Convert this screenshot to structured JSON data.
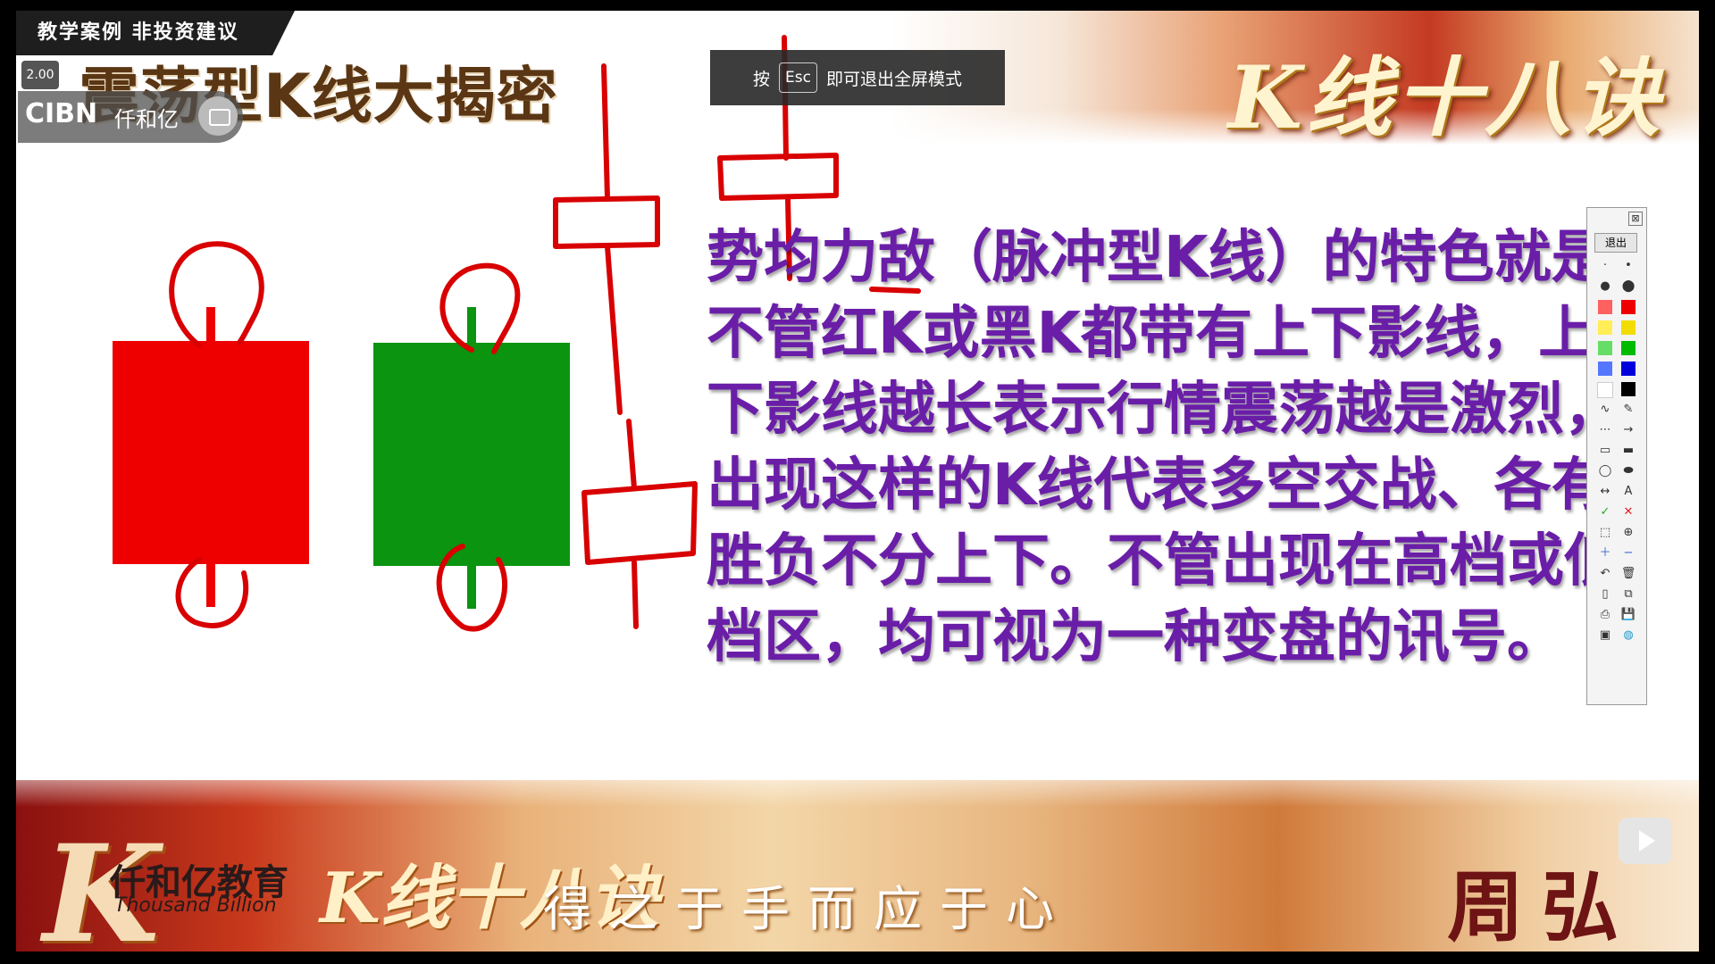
{
  "header": {
    "badge": "教学案例 非投资建议",
    "title": "震荡型K线大揭密",
    "channel": "CIBN",
    "channel_sub": "仟和亿",
    "speed": "2.00",
    "brand_title": "K线十八诀"
  },
  "fullscreen_tip": {
    "prefix": "按",
    "key": "Esc",
    "suffix": "即可退出全屏模式"
  },
  "content": {
    "paragraph": "势均力敌（脉冲型K线）的特色就是不管红K或黑K都带有上下影线，上下影线越长表示行情震荡越是激烈，出现这样的K线代表多空交战、各有胜负不分上下。不管出现在高档或低档区，均可视为一种变盘的讯号。"
  },
  "toolbar": {
    "exit_label": "退出",
    "close_symbol": "⊠",
    "colors": [
      "#ff6060",
      "#ee0000",
      "#ffee55",
      "#f2dd00",
      "#66dd66",
      "#00bb00",
      "#5577ff",
      "#0000dd",
      "#ffffff",
      "#000000"
    ]
  },
  "footer": {
    "big_text": "K线十八诀",
    "logo_cn": "仟和亿教育",
    "logo_en": "Thousand Billion",
    "slogan": "得之于手而应于心",
    "author": "周弘"
  }
}
